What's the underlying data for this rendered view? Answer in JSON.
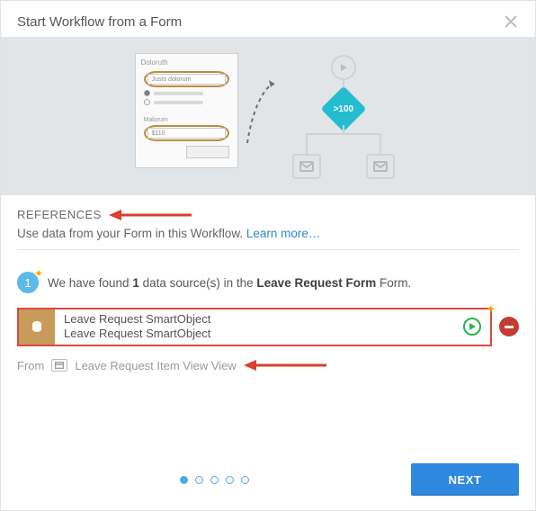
{
  "header": {
    "title": "Start Workflow from a Form"
  },
  "illustration": {
    "form_title": "Doloruth",
    "label1": "Justo dolorum",
    "label2": "Malorum",
    "field2_value": "$110",
    "diamond_text": ">100"
  },
  "references": {
    "title": "REFERENCES",
    "subtitle_prefix": "Use data from your Form in this Workflow.  ",
    "learn_more": "Learn more…"
  },
  "found": {
    "badge": "1",
    "text_prefix": "We have found ",
    "count": "1",
    "text_mid": " data source(s) in the ",
    "form_name": "Leave Request Form",
    "text_suffix": " Form."
  },
  "data_source": {
    "line1": "Leave Request SmartObject",
    "line2": "Leave Request SmartObject"
  },
  "from": {
    "label": "From",
    "view_name": "Leave Request Item View View"
  },
  "pager": {
    "steps": 5,
    "active": 0
  },
  "footer": {
    "next": "NEXT"
  }
}
